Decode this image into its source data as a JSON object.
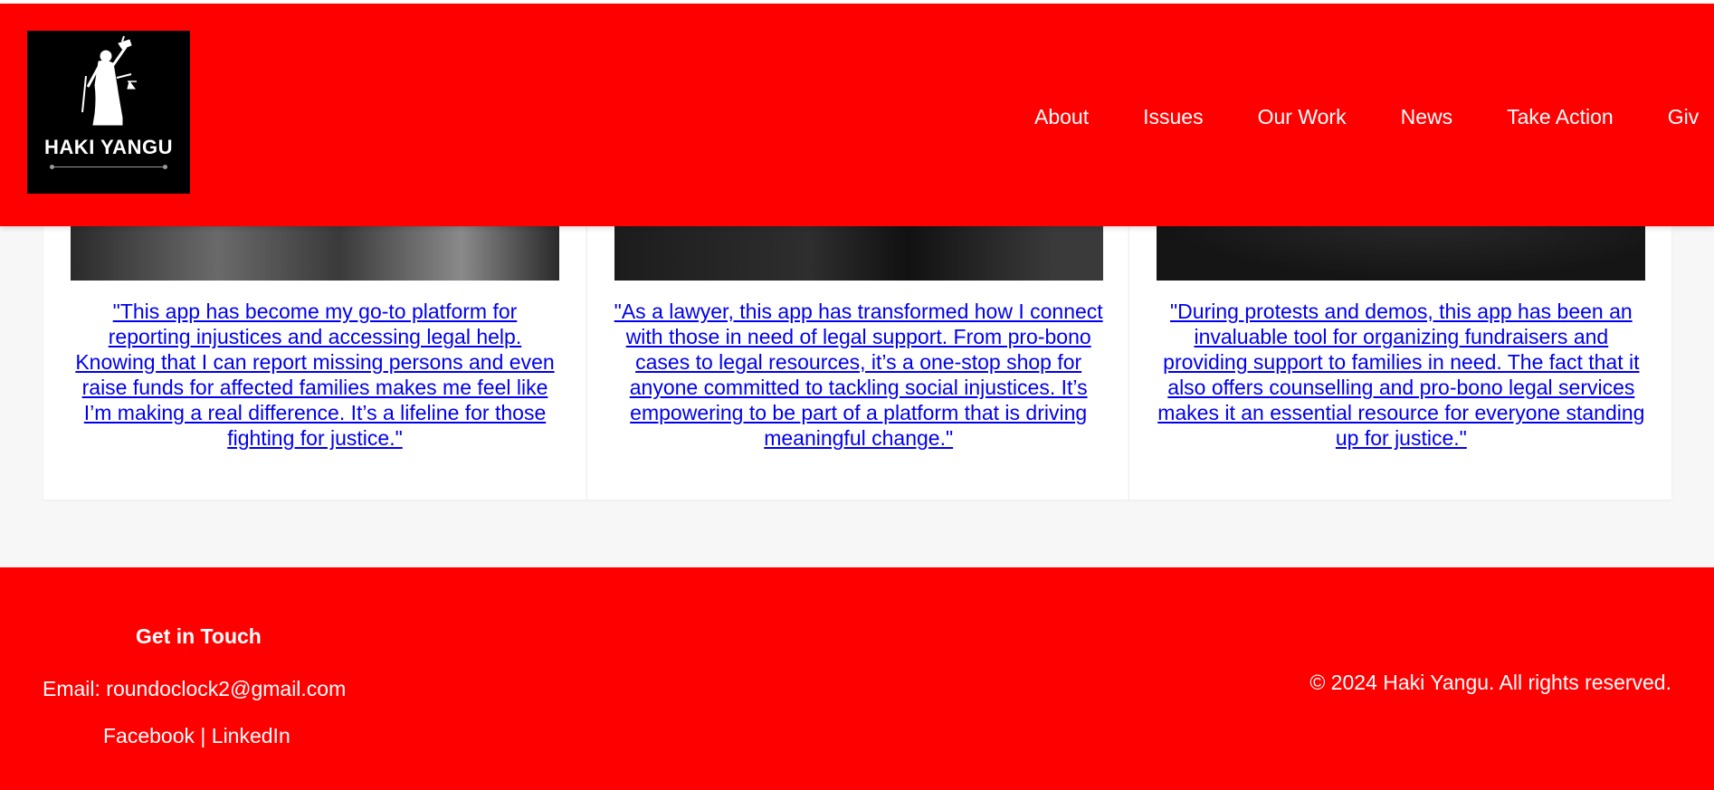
{
  "header": {
    "logo_text": "HAKI YANGU",
    "nav": [
      "About",
      "Issues",
      "Our Work",
      "News",
      "Take Action",
      "Giv"
    ]
  },
  "testimonials": [
    {
      "quote": "\"This app has become my go-to platform for reporting injustices and accessing legal help. Knowing that I can report missing persons and even raise funds for affected families makes me feel like I’m making a real difference. It’s a lifeline for those fighting for justice.\""
    },
    {
      "quote": "\"As a lawyer, this app has transformed how I connect with those in need of legal support. From pro-bono cases to legal resources, it’s a one-stop shop for anyone committed to tackling social injustices. It’s empowering to be part of a platform that is driving meaningful change.\""
    },
    {
      "quote": "\"During protests and demos, this app has been an invaluable tool for organizing fundraisers and providing support to families in need. The fact that it also offers counselling and pro-bono legal services makes it an essential resource for everyone standing up for justice.\""
    }
  ],
  "footer": {
    "heading": "Get in Touch",
    "email": "Email: roundoclock2@gmail.com",
    "facebook": "Facebook",
    "separator": "|",
    "linkedin": "LinkedIn",
    "copyright": "© 2024 Haki Yangu. All rights reserved."
  },
  "colors": {
    "brand_red": "#ff0000",
    "link_blue": "#0000ee",
    "page_bg": "#f7f7f7"
  }
}
